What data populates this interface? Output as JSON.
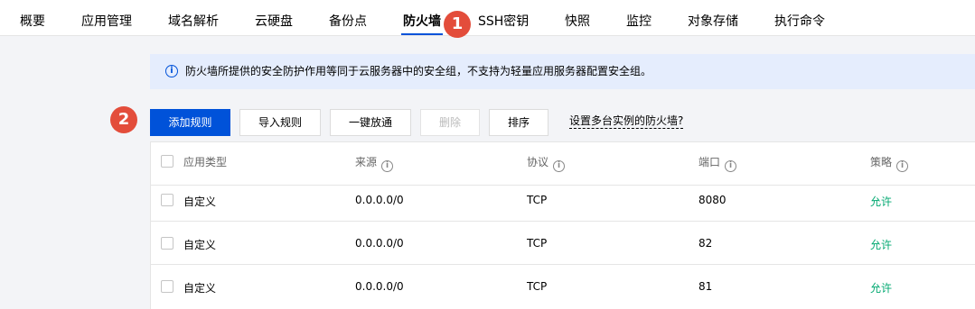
{
  "tabs": [
    "概要",
    "应用管理",
    "域名解析",
    "云硬盘",
    "备份点",
    "防火墙",
    "SSH密钥",
    "快照",
    "监控",
    "对象存储",
    "执行命令"
  ],
  "active_tab": "防火墙",
  "badges": {
    "one": "1",
    "two": "2"
  },
  "notice": {
    "icon": "info-icon",
    "text": "防火墙所提供的安全防护作用等同于云服务器中的安全组，不支持为轻量应用服务器配置安全组。"
  },
  "toolbar": {
    "add_rule": "添加规则",
    "import_rules": "导入规则",
    "allow_all": "一键放通",
    "delete": "删除",
    "sort": "排序",
    "multi_instance_link": "设置多台实例的防火墙?"
  },
  "table": {
    "headers": [
      "应用类型",
      "来源",
      "协议",
      "端口",
      "策略"
    ],
    "rows": [
      {
        "type": "自定义",
        "source": "0.0.0.0/0",
        "protocol": "TCP",
        "port": "8080",
        "policy": "允许"
      },
      {
        "type": "自定义",
        "source": "0.0.0.0/0",
        "protocol": "TCP",
        "port": "82",
        "policy": "允许"
      },
      {
        "type": "自定义",
        "source": "0.0.0.0/0",
        "protocol": "TCP",
        "port": "81",
        "policy": "允许"
      }
    ]
  },
  "colors": {
    "primary": "#0052d9",
    "badge": "#e34d3b",
    "allow": "#00a870",
    "notice_bg": "#e5edfd"
  }
}
